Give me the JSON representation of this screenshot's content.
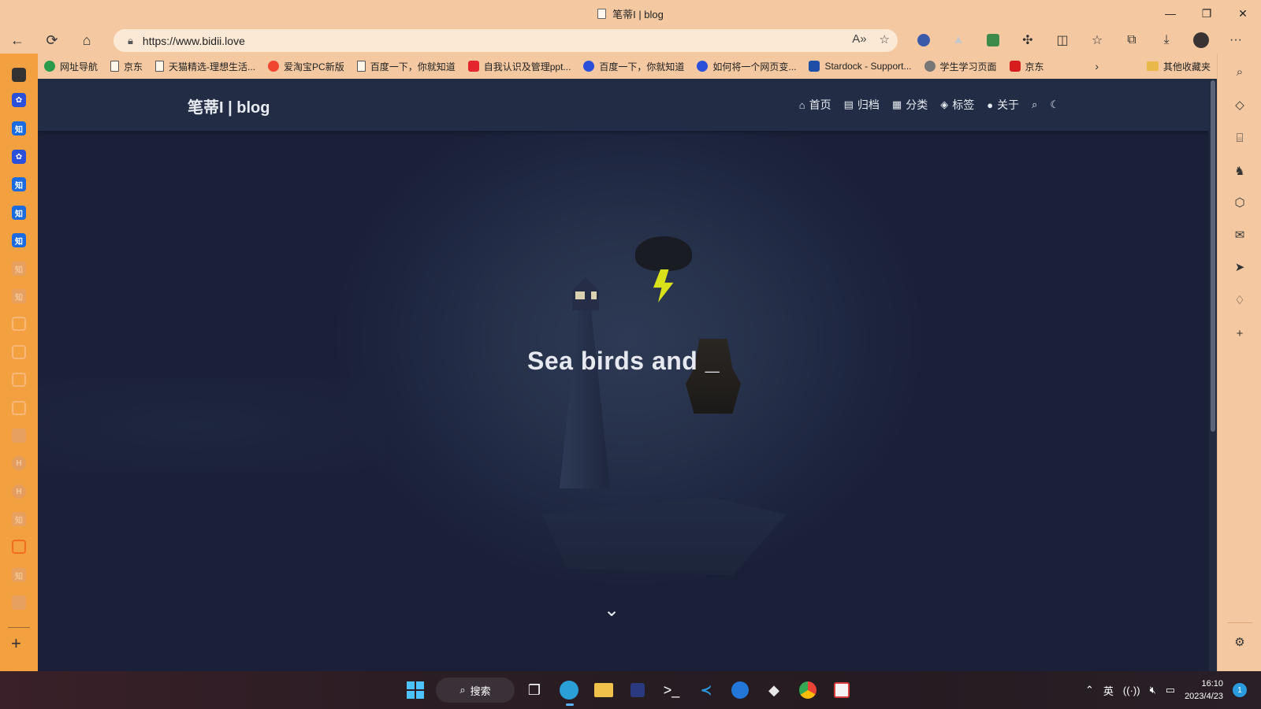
{
  "window": {
    "title": "笔蒂I | blog"
  },
  "browser": {
    "url": "https://www.bidii.love",
    "bookmarks": [
      {
        "label": "网址导航",
        "icon": "edge-icon"
      },
      {
        "label": "京东",
        "icon": "page-icon"
      },
      {
        "label": "天猫精选-理想生活...",
        "icon": "page-icon"
      },
      {
        "label": "爱淘宝PC新版",
        "icon": "taobao-icon"
      },
      {
        "label": "百度一下，你就知道",
        "icon": "page-icon"
      },
      {
        "label": "自我认识及管理ppt...",
        "icon": "d-icon"
      },
      {
        "label": "百度一下，你就知道",
        "icon": "baidu-icon"
      },
      {
        "label": "如何将一个网页变...",
        "icon": "baidu-icon"
      },
      {
        "label": "Stardock - Support...",
        "icon": "stardock-icon"
      },
      {
        "label": "学生学习页面",
        "icon": "globe-icon"
      },
      {
        "label": "京东",
        "icon": "jd-icon"
      }
    ],
    "other_bookmarks": "其他收藏夹"
  },
  "site": {
    "logo": "笔蒂I | blog",
    "nav": [
      {
        "label": "首页",
        "icon": "home-icon"
      },
      {
        "label": "归档",
        "icon": "archive-icon"
      },
      {
        "label": "分类",
        "icon": "category-icon"
      },
      {
        "label": "标签",
        "icon": "tags-icon"
      },
      {
        "label": "关于",
        "icon": "user-icon"
      }
    ],
    "hero_text": "Sea birds and _"
  },
  "taskbar": {
    "search_label": "搜索",
    "ime": "英",
    "time": "16:10",
    "date": "2023/4/23",
    "notifications": "1"
  },
  "colors": {
    "browser_frame": "#f4c9a1",
    "left_sidebar": "#f2a040",
    "page_bg": "#1e2640",
    "bolt": "#d9e11a"
  }
}
